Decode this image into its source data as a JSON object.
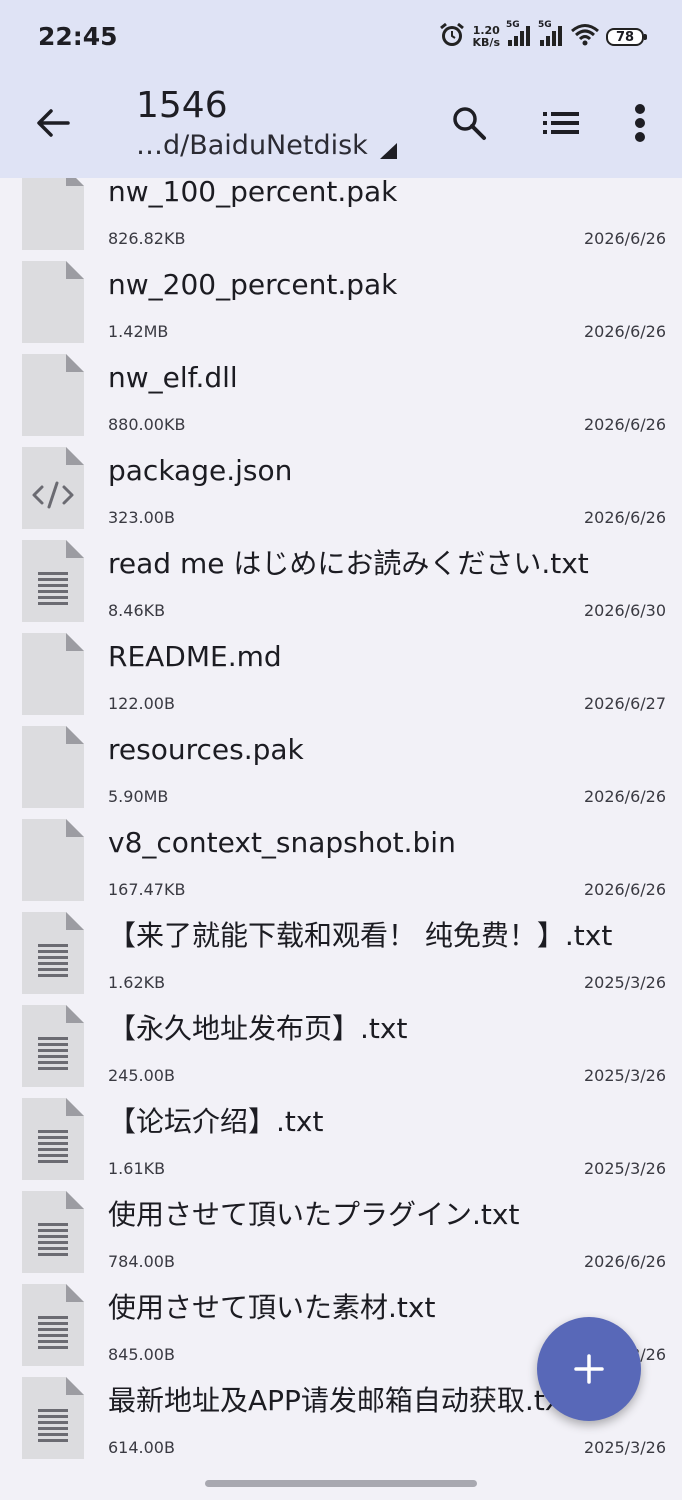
{
  "status_bar": {
    "time": "22:45",
    "speed_value": "1.20",
    "speed_unit": "KB/s",
    "sim1": "5G",
    "sim2": "5G",
    "battery": "78"
  },
  "toolbar": {
    "title": "1546",
    "path": "…d/BaiduNetdisk",
    "icons": [
      "back-arrow-icon",
      "search-icon",
      "list-view-icon",
      "more-vert-icon"
    ]
  },
  "files": [
    {
      "name": "nw_100_percent.pak",
      "size": "826.82KB",
      "date": "2026/6/26",
      "icon": "generic"
    },
    {
      "name": "nw_200_percent.pak",
      "size": "1.42MB",
      "date": "2026/6/26",
      "icon": "generic"
    },
    {
      "name": "nw_elf.dll",
      "size": "880.00KB",
      "date": "2026/6/26",
      "icon": "generic"
    },
    {
      "name": "package.json",
      "size": "323.00B",
      "date": "2026/6/26",
      "icon": "code"
    },
    {
      "name": "read me はじめにお読みください.txt",
      "size": "8.46KB",
      "date": "2026/6/30",
      "icon": "text"
    },
    {
      "name": "README.md",
      "size": "122.00B",
      "date": "2026/6/27",
      "icon": "generic"
    },
    {
      "name": "resources.pak",
      "size": "5.90MB",
      "date": "2026/6/26",
      "icon": "generic"
    },
    {
      "name": "v8_context_snapshot.bin",
      "size": "167.47KB",
      "date": "2026/6/26",
      "icon": "generic"
    },
    {
      "name": "【来了就能下载和观看！ 纯免费！】.txt",
      "size": "1.62KB",
      "date": "2025/3/26",
      "icon": "text"
    },
    {
      "name": "【永久地址发布页】.txt",
      "size": "245.00B",
      "date": "2025/3/26",
      "icon": "text"
    },
    {
      "name": "【论坛介绍】.txt",
      "size": "1.61KB",
      "date": "2025/3/26",
      "icon": "text"
    },
    {
      "name": "使用させて頂いたプラグイン.txt",
      "size": "784.00B",
      "date": "2026/6/26",
      "icon": "text"
    },
    {
      "name": "使用させて頂いた素材.txt",
      "size": "845.00B",
      "date": "2026/3/26",
      "icon": "text"
    },
    {
      "name": "最新地址及APP请发邮箱自动获取.txt",
      "size": "614.00B",
      "date": "2025/3/26",
      "icon": "text"
    }
  ],
  "fab": {
    "icon": "plus-icon"
  },
  "colors": {
    "header_bg": "#dfe3f5",
    "fab_bg": "#5868b8",
    "body_bg": "#f2f1f7"
  }
}
